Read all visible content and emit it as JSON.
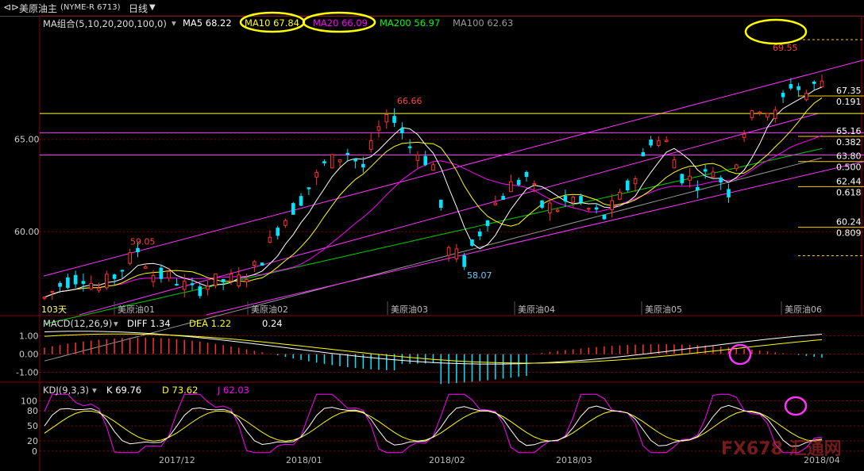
{
  "header": {
    "symbol_icon": "back-icon",
    "instrument": "美原油主",
    "code": "(NYME-R 6713)",
    "period": "日线"
  },
  "ma_header": {
    "label": "MA组合(5,10,20,200,100,0)",
    "items": [
      {
        "text": "MA5 68.22",
        "color": "#ffffff"
      },
      {
        "text": "MA10 67.84",
        "color": "#ffff00"
      },
      {
        "text": "MA20 66.09",
        "color": "#ff00ff"
      },
      {
        "text": "MA200 56.97",
        "color": "#00ff00"
      },
      {
        "text": "MA100 62.63",
        "color": "#999999"
      }
    ]
  },
  "macd_header": {
    "label": "MACD(12,26,9)",
    "diff": "DIFF  1.34",
    "dea": "DEA  1.22",
    "macd": "0.24"
  },
  "kdj_header": {
    "label": "KDJ(9,3,3)",
    "k": "K  69.76",
    "d": "D  73.62",
    "j": "J  62.03"
  },
  "watermark": "FX678 汇通网",
  "colors": {
    "up": "#ff3030",
    "down": "#00e5ff",
    "ma5": "#ffffff",
    "ma10": "#ffff00",
    "ma20": "#ff00ff",
    "ma200": "#00cc00",
    "ma100": "#999999",
    "grid": "#8b0000",
    "highlight": "#ffff00",
    "highlight2": "#ff33ff"
  },
  "chart_data": [
    {
      "type": "candlestick",
      "ylim": [
        55.5,
        71.0
      ],
      "y_ticks": [
        {
          "value": 60.0,
          "label": "60.00"
        },
        {
          "value": 65.0,
          "label": "65.00"
        }
      ],
      "x_labels": [
        "美原油01",
        "美原油02",
        "美原油03",
        "美原油04",
        "美原油05",
        "美原油06"
      ],
      "corner_label": "103天",
      "annotations": [
        {
          "text": "59.05",
          "value": 59.05,
          "color": "#ff4040"
        },
        {
          "text": "66.66",
          "value": 66.66,
          "color": "#ff4040"
        },
        {
          "text": "58.07",
          "value": 58.07,
          "color": "#66ccff"
        },
        {
          "text": "69.55",
          "value": 69.55,
          "color": "#ff4040"
        }
      ],
      "fib_levels": [
        {
          "ratio": "0.191",
          "price": "67.35",
          "value": 67.35
        },
        {
          "ratio": "0.382",
          "price": "65.16",
          "value": 65.16
        },
        {
          "ratio": "0.500",
          "price": "63.80",
          "value": 63.8
        },
        {
          "ratio": "0.618",
          "price": "62.44",
          "value": 62.44
        },
        {
          "ratio": "0.809",
          "price": "60.24",
          "value": 60.24
        }
      ],
      "h_lines": [
        {
          "value": 66.4,
          "color": "#ffff33"
        },
        {
          "value": 65.35,
          "color": "#ff33ff"
        },
        {
          "value": 64.15,
          "color": "#ff33ff"
        }
      ],
      "ma_last": {
        "MA5": 68.22,
        "MA10": 67.84,
        "MA20": 66.09,
        "MA200": 56.97,
        "MA100": 62.63
      }
    },
    {
      "type": "bar",
      "name": "MACD",
      "ylim": [
        -1.5,
        1.5
      ],
      "y_ticks": [
        {
          "value": 1.0,
          "label": "1.00"
        },
        {
          "value": 0.0,
          "label": "0.00"
        },
        {
          "value": -1.0,
          "label": "-1.00"
        }
      ],
      "last": {
        "DIFF": 1.34,
        "DEA": 1.22,
        "MACD": 0.24
      }
    },
    {
      "type": "line",
      "name": "KDJ",
      "ylim": [
        -5,
        115
      ],
      "y_ticks": [
        {
          "value": 100,
          "label": "100"
        },
        {
          "value": 80,
          "label": "80"
        },
        {
          "value": 50,
          "label": "50"
        },
        {
          "value": 20,
          "label": "20"
        },
        {
          "value": 0,
          "label": "0"
        }
      ],
      "x_labels": [
        "2017/12",
        "2018/01",
        "2018/02",
        "2018/03",
        "2018/04"
      ],
      "last": {
        "K": 69.76,
        "D": 73.62,
        "J": 62.03
      }
    }
  ]
}
